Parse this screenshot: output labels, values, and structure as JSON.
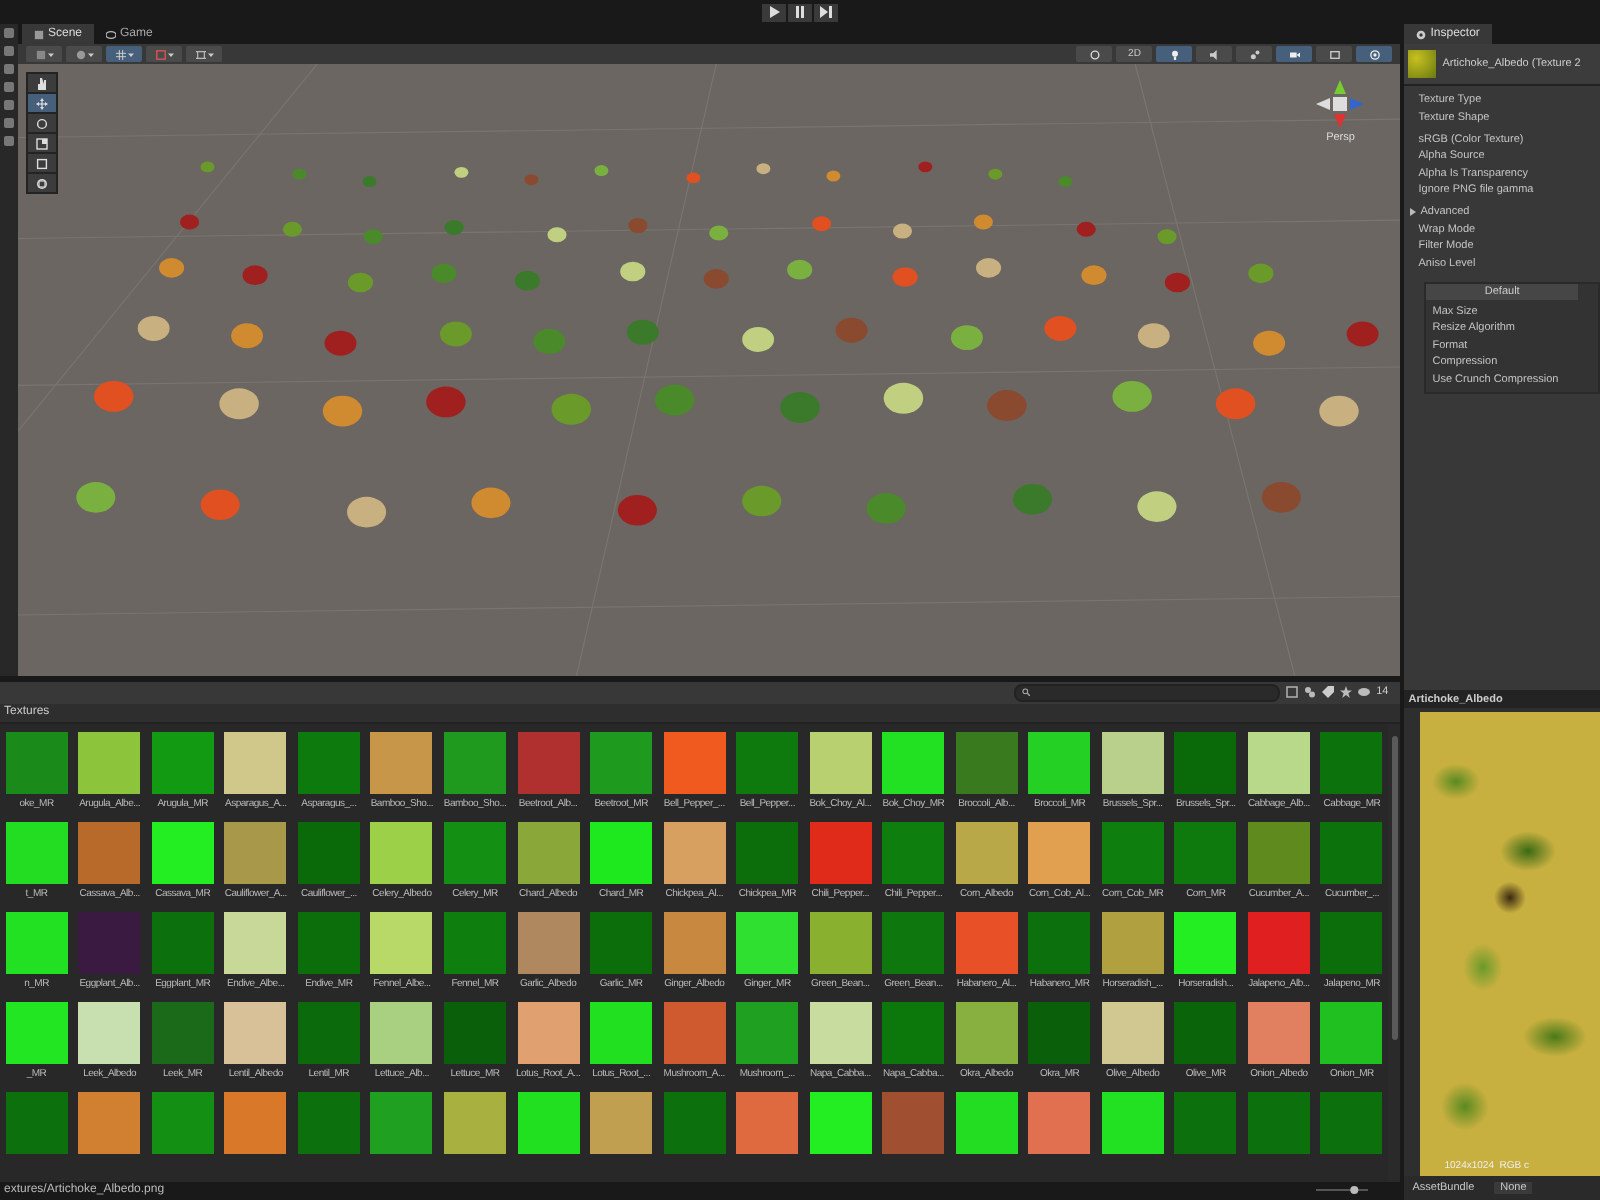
{
  "top_bar": {
    "controls": [
      {
        "kind": "play"
      },
      {
        "kind": "pause"
      },
      {
        "kind": "step"
      }
    ]
  },
  "scene": {
    "tabs": [
      {
        "label": "Scene",
        "kind": "scene",
        "selected": true
      },
      {
        "label": "Game",
        "kind": "game",
        "selected": false
      }
    ],
    "left_tools": [
      {
        "kind": "draw",
        "on": false
      },
      {
        "kind": "globe",
        "on": false
      },
      {
        "kind": "grid",
        "on": true
      },
      {
        "kind": "snap",
        "on": false
      },
      {
        "kind": "increment",
        "on": false
      }
    ],
    "right_tools": [
      {
        "kind": "shading",
        "on": false
      },
      {
        "kind": "text",
        "label": "2D",
        "on": false
      },
      {
        "kind": "light",
        "on": true
      },
      {
        "kind": "audio",
        "on": false
      },
      {
        "kind": "fx",
        "on": false
      },
      {
        "kind": "camera",
        "on": true
      },
      {
        "kind": "scene-camera",
        "on": false
      },
      {
        "kind": "gizmos",
        "on": true
      }
    ],
    "tools": [
      {
        "kind": "hand",
        "selected": false
      },
      {
        "kind": "move",
        "selected": true
      },
      {
        "kind": "rotate",
        "selected": false
      },
      {
        "kind": "scale",
        "selected": false
      },
      {
        "kind": "rect",
        "selected": false
      },
      {
        "kind": "transform",
        "selected": false
      }
    ],
    "gizmo_label": "Persp"
  },
  "inspector": {
    "tab": "Inspector",
    "title": "Artichoke_Albedo (Texture 2",
    "field_groups": [
      [
        {
          "kind": "label",
          "label": "Texture Type"
        },
        {
          "kind": "label",
          "label": "Texture Shape"
        }
      ],
      [
        {
          "kind": "label",
          "label": "sRGB (Color Texture)"
        },
        {
          "kind": "label",
          "label": "Alpha Source"
        },
        {
          "kind": "label",
          "label": "Alpha Is Transparency"
        },
        {
          "kind": "label",
          "label": "Ignore PNG file gamma"
        }
      ],
      [
        {
          "kind": "foldout",
          "label": "Advanced",
          "expanded": false
        },
        {
          "kind": "label",
          "label": "Wrap Mode"
        },
        {
          "kind": "label",
          "label": "Filter Mode"
        },
        {
          "kind": "label",
          "label": "Aniso Level"
        }
      ]
    ],
    "platform_box": {
      "tab": "Default",
      "fields": [
        "Max Size",
        "Resize Algorithm",
        "Format",
        "Compression",
        "Use Crunch Compression"
      ]
    },
    "preview": {
      "title": "Artichoke_Albedo",
      "info": "1024x1024  RGB c"
    },
    "asset_bundle": {
      "label": "AssetBundle",
      "value": "None"
    }
  },
  "project": {
    "breadcrumb": "Textures",
    "count": "14",
    "path": "extures/Artichoke_Albedo.png",
    "zoom_slider": {
      "level": 0.78
    },
    "tiles": [
      {
        "label": "oke_MR",
        "color": "#1a8a1a"
      },
      {
        "label": "Arugula_Albe...",
        "color": "#8cc43c"
      },
      {
        "label": "Arugula_MR",
        "color": "#139a13"
      },
      {
        "label": "Asparagus_A...",
        "color": "#cfc88a"
      },
      {
        "label": "Asparagus_...",
        "color": "#0d7a0d"
      },
      {
        "label": "Bamboo_Sho...",
        "color": "#c89648"
      },
      {
        "label": "Bamboo_Sho...",
        "color": "#1f9a1f"
      },
      {
        "label": "Beetroot_Alb...",
        "color": "#b03030"
      },
      {
        "label": "Beetroot_MR",
        "color": "#1e9a1e"
      },
      {
        "label": "Bell_Pepper_...",
        "color": "#f05a1e"
      },
      {
        "label": "Bell_Pepper...",
        "color": "#0e7a0e"
      },
      {
        "label": "Bok_Choy_Al...",
        "color": "#b8d070"
      },
      {
        "label": "Bok_Choy_MR",
        "color": "#22e022"
      },
      {
        "label": "Broccoli_Alb...",
        "color": "#3a7a1e"
      },
      {
        "label": "Broccoli_MR",
        "color": "#24d024"
      },
      {
        "label": "Brussels_Spr...",
        "color": "#b8d08c"
      },
      {
        "label": "Brussels_Spr...",
        "color": "#0a6a0a"
      },
      {
        "label": "Cabbage_Alb...",
        "color": "#b8d88a"
      },
      {
        "label": "Cabbage_MR",
        "color": "#0c720c"
      },
      {
        "label": "t_MR",
        "color": "#22dd22"
      },
      {
        "label": "Cassava_Alb...",
        "color": "#b86a2a"
      },
      {
        "label": "Cassava_MR",
        "color": "#22ee22"
      },
      {
        "label": "Cauliflower_A...",
        "color": "#a8984a"
      },
      {
        "label": "Cauliflower_...",
        "color": "#0a6a0a"
      },
      {
        "label": "Celery_Albedo",
        "color": "#9cd048"
      },
      {
        "label": "Celery_MR",
        "color": "#138f13"
      },
      {
        "label": "Chard_Albedo",
        "color": "#8aa83a"
      },
      {
        "label": "Chard_MR",
        "color": "#1ee81e"
      },
      {
        "label": "Chickpea_Al...",
        "color": "#d8a060"
      },
      {
        "label": "Chickpea_MR",
        "color": "#0b6e0b"
      },
      {
        "label": "Chili_Pepper...",
        "color": "#e02a1a"
      },
      {
        "label": "Chili_Pepper...",
        "color": "#0e7e0e"
      },
      {
        "label": "Corn_Albedo",
        "color": "#b8a848"
      },
      {
        "label": "Corn_Cob_Al...",
        "color": "#e0a050"
      },
      {
        "label": "Corn_Cob_MR",
        "color": "#0e7e0e"
      },
      {
        "label": "Corn_MR",
        "color": "#0e7a0e"
      },
      {
        "label": "Cucumber_A...",
        "color": "#5e8a1e"
      },
      {
        "label": "Cucumber_...",
        "color": "#0c720c"
      },
      {
        "label": "n_MR",
        "color": "#22e022"
      },
      {
        "label": "Eggplant_Alb...",
        "color": "#3a1a40"
      },
      {
        "label": "Eggplant_MR",
        "color": "#0c700c"
      },
      {
        "label": "Endive_Albe...",
        "color": "#c8d898"
      },
      {
        "label": "Endive_MR",
        "color": "#0b6e0b"
      },
      {
        "label": "Fennel_Albe...",
        "color": "#b8d868"
      },
      {
        "label": "Fennel_MR",
        "color": "#0e7e0e"
      },
      {
        "label": "Garlic_Albedo",
        "color": "#b08860"
      },
      {
        "label": "Garlic_MR",
        "color": "#0b6e0b"
      },
      {
        "label": "Ginger_Albedo",
        "color": "#c88840"
      },
      {
        "label": "Ginger_MR",
        "color": "#30e030"
      },
      {
        "label": "Green_Bean...",
        "color": "#8ab030"
      },
      {
        "label": "Green_Bean...",
        "color": "#0e780e"
      },
      {
        "label": "Habanero_Al...",
        "color": "#e85028"
      },
      {
        "label": "Habanero_MR",
        "color": "#0c700c"
      },
      {
        "label": "Horseradish_...",
        "color": "#b0a040"
      },
      {
        "label": "Horseradish...",
        "color": "#22ee22"
      },
      {
        "label": "Jalapeno_Alb...",
        "color": "#e02020"
      },
      {
        "label": "Jalapeno_MR",
        "color": "#0b6e0b"
      },
      {
        "label": "_MR",
        "color": "#22e622"
      },
      {
        "label": "Leek_Albedo",
        "color": "#c8e0b0"
      },
      {
        "label": "Leek_MR",
        "color": "#1a6a1a"
      },
      {
        "label": "Lentil_Albedo",
        "color": "#d8c098"
      },
      {
        "label": "Lentil_MR",
        "color": "#0b6a0b"
      },
      {
        "label": "Lettuce_Alb...",
        "color": "#a8d080"
      },
      {
        "label": "Lettuce_MR",
        "color": "#0a600a"
      },
      {
        "label": "Lotus_Root_A...",
        "color": "#e0a070"
      },
      {
        "label": "Lotus_Root_...",
        "color": "#20e020"
      },
      {
        "label": "Mushroom_A...",
        "color": "#d05a30"
      },
      {
        "label": "Mushroom_...",
        "color": "#20a020"
      },
      {
        "label": "Napa_Cabba...",
        "color": "#c8dca0"
      },
      {
        "label": "Napa_Cabba...",
        "color": "#0c780c"
      },
      {
        "label": "Okra_Albedo",
        "color": "#88b040"
      },
      {
        "label": "Okra_MR",
        "color": "#0a600a"
      },
      {
        "label": "Olive_Albedo",
        "color": "#d0c890"
      },
      {
        "label": "Olive_MR",
        "color": "#0a640a"
      },
      {
        "label": "Onion_Albedo",
        "color": "#e08060"
      },
      {
        "label": "Onion_MR",
        "color": "#20c020"
      },
      {
        "color": "#0c700c"
      },
      {
        "color": "#d08030"
      },
      {
        "color": "#138f13"
      },
      {
        "color": "#d87828"
      },
      {
        "color": "#0c700c"
      },
      {
        "color": "#20a020"
      },
      {
        "color": "#a8b040"
      },
      {
        "color": "#20e020"
      },
      {
        "color": "#c0a050"
      },
      {
        "color": "#0c700c"
      },
      {
        "color": "#e06a40"
      },
      {
        "color": "#22ee22"
      },
      {
        "color": "#a05030"
      },
      {
        "color": "#22dd22"
      },
      {
        "color": "#e07050"
      },
      {
        "color": "#22e022"
      },
      {
        "color": "#0c700c"
      },
      {
        "color": "#0c700c"
      },
      {
        "color": "#0c700c"
      }
    ]
  }
}
